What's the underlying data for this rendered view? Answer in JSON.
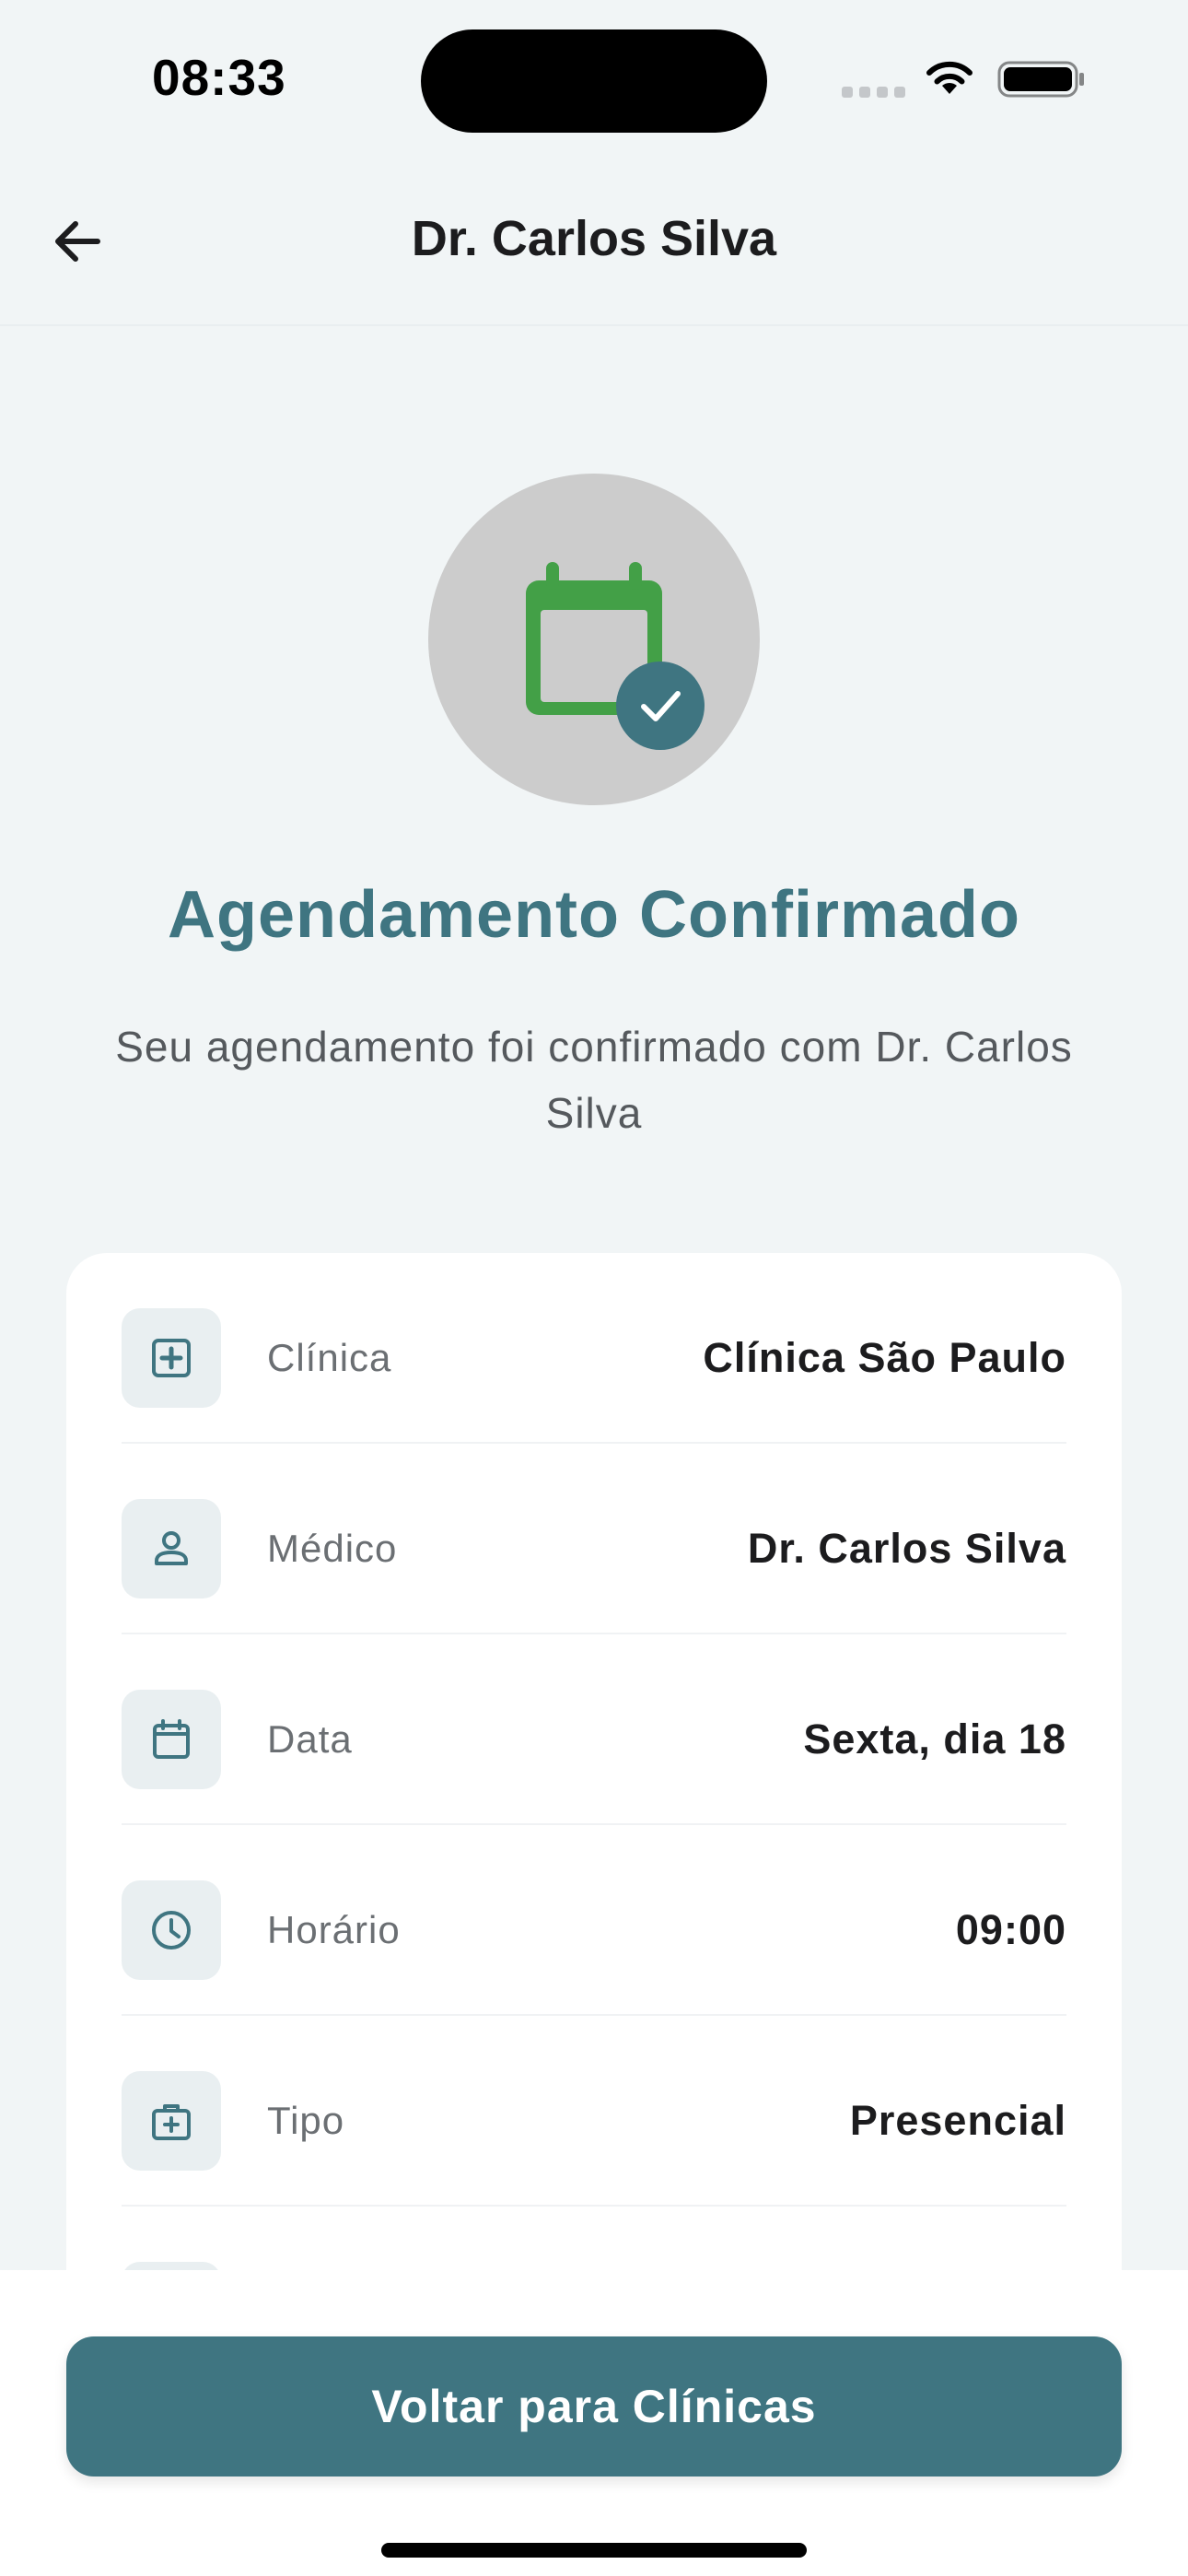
{
  "status_bar": {
    "time": "08:33"
  },
  "header": {
    "title": "Dr. Carlos Silva",
    "back_icon": "arrow-left-icon"
  },
  "hero": {
    "icon": "calendar-check-icon",
    "title": "Agendamento Confirmado",
    "subtitle": "Seu agendamento foi confirmado com Dr. Carlos Silva"
  },
  "details": [
    {
      "icon": "medical-plus-icon",
      "label": "Clínica",
      "value": "Clínica São Paulo"
    },
    {
      "icon": "person-icon",
      "label": "Médico",
      "value": "Dr. Carlos Silva"
    },
    {
      "icon": "calendar-icon",
      "label": "Data",
      "value": "Sexta, dia 18"
    },
    {
      "icon": "clock-icon",
      "label": "Horário",
      "value": "09:00"
    },
    {
      "icon": "medical-bag-icon",
      "label": "Tipo",
      "value": "Presencial"
    }
  ],
  "actions": {
    "primary_label": "Voltar para Clínicas"
  },
  "colors": {
    "background": "#F1F5F6",
    "accent": "#3F7581",
    "calendar_green": "#43A047",
    "hero_circle": "#CCCCCC",
    "icon_tile": "#E9EFF1"
  }
}
